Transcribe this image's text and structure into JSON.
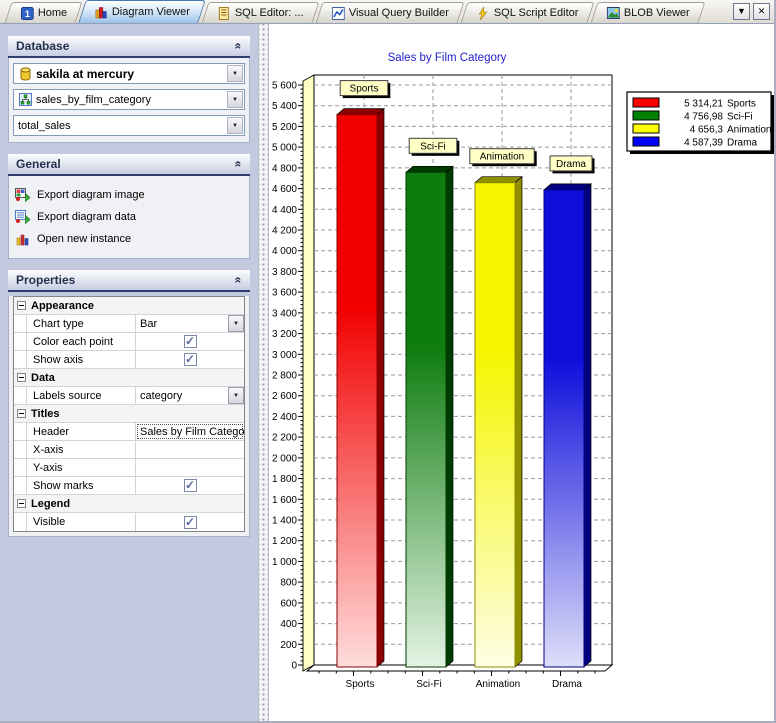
{
  "window": {
    "dropdown_label": "▼",
    "close_label": "✕"
  },
  "tabs": [
    {
      "label": "Home",
      "icon": "home-icon",
      "active": false
    },
    {
      "label": "Diagram Viewer",
      "icon": "diagram-viewer-icon",
      "active": true
    },
    {
      "label": "SQL Editor: ...",
      "icon": "sql-editor-icon",
      "active": false
    },
    {
      "label": "Visual Query Builder",
      "icon": "query-builder-icon",
      "active": false
    },
    {
      "label": "SQL Script Editor",
      "icon": "script-editor-icon",
      "active": false
    },
    {
      "label": "BLOB Viewer",
      "icon": "blob-viewer-icon",
      "active": false
    }
  ],
  "sidebar": {
    "database": {
      "title": "Database",
      "combos": [
        {
          "name": "connection-select",
          "value": "sakila at mercury",
          "icon": "database-icon",
          "bold": true
        },
        {
          "name": "object-select",
          "value": "sales_by_film_category",
          "icon": "view-icon",
          "bold": false
        },
        {
          "name": "column-select",
          "value": "total_sales",
          "icon": "",
          "bold": false
        }
      ]
    },
    "general": {
      "title": "General",
      "items": [
        {
          "label": "Export diagram image",
          "icon": "export-image-icon"
        },
        {
          "label": "Export diagram data",
          "icon": "export-data-icon"
        },
        {
          "label": "Open new instance",
          "icon": "new-instance-icon"
        }
      ]
    },
    "properties": {
      "title": "Properties",
      "groups": [
        {
          "label": "Appearance",
          "rows": [
            {
              "label": "Chart type",
              "type": "dropdown",
              "value": "Bar"
            },
            {
              "label": "Color each point",
              "type": "checkbox",
              "checked": true
            },
            {
              "label": "Show axis",
              "type": "checkbox",
              "checked": true
            }
          ]
        },
        {
          "label": "Data",
          "rows": [
            {
              "label": "Labels source",
              "type": "dropdown",
              "value": "category"
            }
          ]
        },
        {
          "label": "Titles",
          "rows": [
            {
              "label": "Header",
              "type": "text",
              "value": "Sales by Film Category",
              "focused": true
            },
            {
              "label": "X-axis",
              "type": "text",
              "value": ""
            },
            {
              "label": "Y-axis",
              "type": "text",
              "value": ""
            },
            {
              "label": "Show marks",
              "type": "checkbox",
              "checked": true
            }
          ]
        },
        {
          "label": "Legend",
          "rows": [
            {
              "label": "Visible",
              "type": "checkbox",
              "checked": true
            }
          ]
        }
      ]
    }
  },
  "chart_data": {
    "type": "bar",
    "title": "Sales by Film Category",
    "title_color": "#2222CC",
    "categories": [
      "Sports",
      "Sci-Fi",
      "Animation",
      "Drama"
    ],
    "values": [
      5314.21,
      4756.98,
      4656.3,
      4587.39
    ],
    "bar_colors": [
      "#F20000",
      "#0E7C0E",
      "#F5F500",
      "#0D0DDC"
    ],
    "bar_dark_colors": [
      "#8B0000",
      "#003C00",
      "#8F8F00",
      "#000080"
    ],
    "bar_light_colors": [
      "#FFDCDC",
      "#E4F3E4",
      "#FEFEE4",
      "#DEDEF9"
    ],
    "xlabel": "",
    "ylabel": "",
    "grid": true,
    "legend": {
      "position": "top-right",
      "entries": [
        {
          "value_label": "5 314,21",
          "name": "Sports",
          "color": "#FF0000"
        },
        {
          "value_label": "4 756,98",
          "name": "Sci-Fi",
          "color": "#008000"
        },
        {
          "value_label": "4 656,3",
          "name": "Animation",
          "color": "#FFFF00"
        },
        {
          "value_label": "4 587,39",
          "name": "Drama",
          "color": "#0000FF"
        }
      ]
    },
    "y_axis": {
      "min": 0,
      "max": 5600,
      "step": 200,
      "minor_step": 40,
      "tick_labels": [
        "0",
        "200",
        "400",
        "600",
        "800",
        "1 000",
        "1 200",
        "1 400",
        "1 600",
        "1 800",
        "2 000",
        "2 200",
        "2 400",
        "2 600",
        "2 800",
        "3 000",
        "3 200",
        "3 400",
        "3 600",
        "3 800",
        "4 000",
        "4 200",
        "4 400",
        "4 600",
        "4 800",
        "5 000",
        "5 200",
        "5 400",
        "5 600"
      ]
    },
    "marks": [
      "Sports",
      "Sci-Fi",
      "Animation",
      "Drama"
    ]
  }
}
